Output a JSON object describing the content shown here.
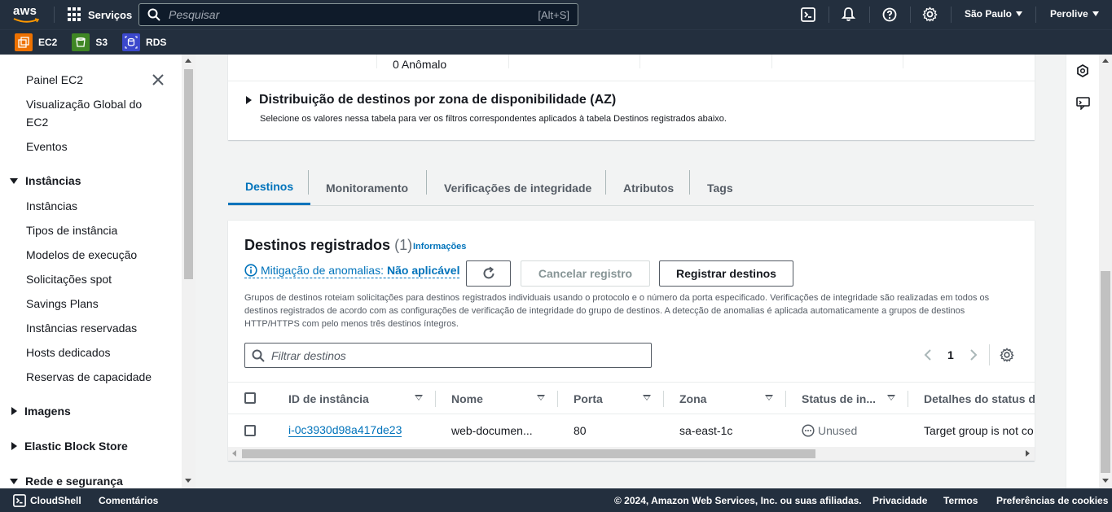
{
  "topbar": {
    "services_label": "Serviços",
    "search_placeholder": "Pesquisar",
    "search_shortcut": "[Alt+S]",
    "region": "São Paulo",
    "account": "Perolive"
  },
  "favorites": [
    {
      "label": "EC2",
      "color": "#ed7100"
    },
    {
      "label": "S3",
      "color": "#3f8624"
    },
    {
      "label": "RDS",
      "color": "#3b48cc"
    }
  ],
  "sidebar": {
    "items": [
      {
        "label": "Painel EC2"
      },
      {
        "label": "Visualização Global do"
      },
      {
        "label": "EC2"
      },
      {
        "label": "Eventos"
      }
    ],
    "instances_section": "Instâncias",
    "instances_items": [
      "Instâncias",
      "Tipos de instância",
      "Modelos de execução",
      "Solicitações spot",
      "Savings Plans",
      "Instâncias reservadas",
      "Hosts dedicados",
      "Reservas de capacidade"
    ],
    "sections_collapsed": [
      "Imagens",
      "Elastic Block Store"
    ],
    "network_section": "Rede e segurança"
  },
  "stats": {
    "anomalous": "0 Anômalo"
  },
  "az": {
    "title": "Distribuição de destinos por zona de disponibilidade (AZ)",
    "description": "Selecione os valores nessa tabela para ver os filtros correspondentes aplicados à tabela Destinos registrados abaixo."
  },
  "tabs": [
    "Destinos",
    "Monitoramento",
    "Verificações de integridade",
    "Atributos",
    "Tags"
  ],
  "registered": {
    "title": "Destinos registrados",
    "count": "(1)",
    "info": "Informações",
    "mitigation_label": "Mitigação de anomalias:",
    "mitigation_value": "Não aplicável",
    "cancel_button": "Cancelar registro",
    "register_button": "Registrar destinos",
    "description": "Grupos de destinos roteiam solicitações para destinos registrados individuais usando o protocolo e o número da porta especificado. Verificações de integridade são realizadas em todos os destinos registrados de acordo com as configurações de verificação de integridade do grupo de destinos. A detecção de anomalias é aplicada automaticamente a grupos de destinos HTTP/HTTPS com pelo menos três destinos íntegros.",
    "filter_placeholder": "Filtrar destinos",
    "page": "1",
    "columns": [
      "ID de instância",
      "Nome",
      "Porta",
      "Zona",
      "Status de in...",
      "Detalhes do status de"
    ],
    "rows": [
      {
        "id": "i-0c3930d98a417de23",
        "name": "web-documen...",
        "port": "80",
        "zone": "sa-east-1c",
        "status": "Unused",
        "details": "Target group is not co"
      }
    ]
  },
  "footer": {
    "cloudshell": "CloudShell",
    "comments": "Comentários",
    "copyright": "© 2024, Amazon Web Services, Inc. ou suas afiliadas.",
    "privacy": "Privacidade",
    "terms": "Termos",
    "cookies": "Preferências de cookies"
  }
}
